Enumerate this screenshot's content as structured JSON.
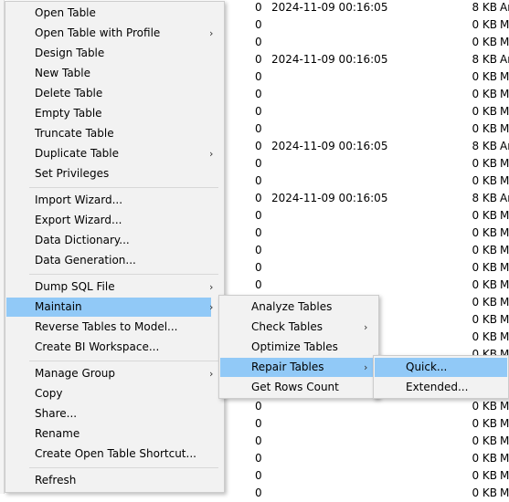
{
  "background_rows": [
    {
      "count": "0",
      "modified": "2024-11-09 00:16:05",
      "size": "8 KB",
      "engine": "Ar"
    },
    {
      "count": "0",
      "modified": "",
      "size": "0 KB",
      "engine": "M"
    },
    {
      "count": "0",
      "modified": "",
      "size": "0 KB",
      "engine": "M"
    },
    {
      "count": "0",
      "modified": "2024-11-09 00:16:05",
      "size": "8 KB",
      "engine": "Ar"
    },
    {
      "count": "0",
      "modified": "",
      "size": "0 KB",
      "engine": "M"
    },
    {
      "count": "0",
      "modified": "",
      "size": "0 KB",
      "engine": "M"
    },
    {
      "count": "0",
      "modified": "",
      "size": "0 KB",
      "engine": "M"
    },
    {
      "count": "0",
      "modified": "",
      "size": "0 KB",
      "engine": "M"
    },
    {
      "count": "0",
      "modified": "2024-11-09 00:16:05",
      "size": "8 KB",
      "engine": "Ar"
    },
    {
      "count": "0",
      "modified": "",
      "size": "0 KB",
      "engine": "M"
    },
    {
      "count": "0",
      "modified": "",
      "size": "0 KB",
      "engine": "M"
    },
    {
      "count": "0",
      "modified": "2024-11-09 00:16:05",
      "size": "8 KB",
      "engine": "Ar"
    },
    {
      "count": "0",
      "modified": "",
      "size": "0 KB",
      "engine": "M"
    },
    {
      "count": "0",
      "modified": "",
      "size": "0 KB",
      "engine": "M"
    },
    {
      "count": "0",
      "modified": "",
      "size": "0 KB",
      "engine": "M"
    },
    {
      "count": "0",
      "modified": "",
      "size": "0 KB",
      "engine": "M"
    },
    {
      "count": "0",
      "modified": "",
      "size": "0 KB",
      "engine": "M"
    },
    {
      "count": "0",
      "modified": "",
      "size": "0 KB",
      "engine": "M"
    },
    {
      "count": "0",
      "modified": "",
      "size": "0 KB",
      "engine": "M"
    },
    {
      "count": "0",
      "modified": "",
      "size": "0 KB",
      "engine": "M"
    },
    {
      "count": "0",
      "modified": "",
      "size": "0 KB",
      "engine": "M"
    },
    {
      "count": "0",
      "modified": "",
      "size": "0 KB",
      "engine": "M"
    },
    {
      "count": "0",
      "modified": "",
      "size": "0 KB",
      "engine": "M"
    },
    {
      "count": "0",
      "modified": "",
      "size": "0 KB",
      "engine": "M"
    },
    {
      "count": "0",
      "modified": "",
      "size": "0 KB",
      "engine": "M"
    },
    {
      "count": "0",
      "modified": "",
      "size": "0 KB",
      "engine": "M"
    },
    {
      "count": "0",
      "modified": "",
      "size": "0 KB",
      "engine": "M"
    },
    {
      "count": "0",
      "modified": "",
      "size": "0 KB",
      "engine": "M"
    },
    {
      "count": "0",
      "modified": "",
      "size": "0 KB",
      "engine": "M"
    }
  ],
  "context_menu": {
    "items": [
      {
        "label": "Open Table"
      },
      {
        "label": "Open Table with Profile",
        "submenu": true
      },
      {
        "label": "Design Table"
      },
      {
        "label": "New Table"
      },
      {
        "label": "Delete Table"
      },
      {
        "label": "Empty Table"
      },
      {
        "label": "Truncate Table"
      },
      {
        "label": "Duplicate Table",
        "submenu": true
      },
      {
        "label": "Set Privileges",
        "sep_after": true
      },
      {
        "label": "Import Wizard..."
      },
      {
        "label": "Export Wizard..."
      },
      {
        "label": "Data Dictionary..."
      },
      {
        "label": "Data Generation...",
        "sep_after": true
      },
      {
        "label": "Dump SQL File",
        "submenu": true
      },
      {
        "label": "Maintain",
        "submenu": true,
        "highlighted": true
      },
      {
        "label": "Reverse Tables to Model..."
      },
      {
        "label": "Create BI Workspace...",
        "sep_after": true
      },
      {
        "label": "Manage Group",
        "submenu": true
      },
      {
        "label": "Copy"
      },
      {
        "label": "Share..."
      },
      {
        "label": "Rename"
      },
      {
        "label": "Create Open Table Shortcut...",
        "sep_after": true
      },
      {
        "label": "Refresh"
      }
    ]
  },
  "maintain_submenu": {
    "items": [
      {
        "label": "Analyze Tables"
      },
      {
        "label": "Check Tables",
        "submenu": true
      },
      {
        "label": "Optimize Tables"
      },
      {
        "label": "Repair Tables",
        "submenu": true,
        "highlighted": true
      },
      {
        "label": "Get Rows Count"
      }
    ]
  },
  "repair_submenu": {
    "items": [
      {
        "label": "Quick...",
        "highlighted": true
      },
      {
        "label": "Extended..."
      }
    ]
  },
  "colors": {
    "highlight": "#91c9f7",
    "menu_bg": "#f2f2f2"
  },
  "icons": {
    "submenu_arrow": "chevron-right-icon"
  }
}
